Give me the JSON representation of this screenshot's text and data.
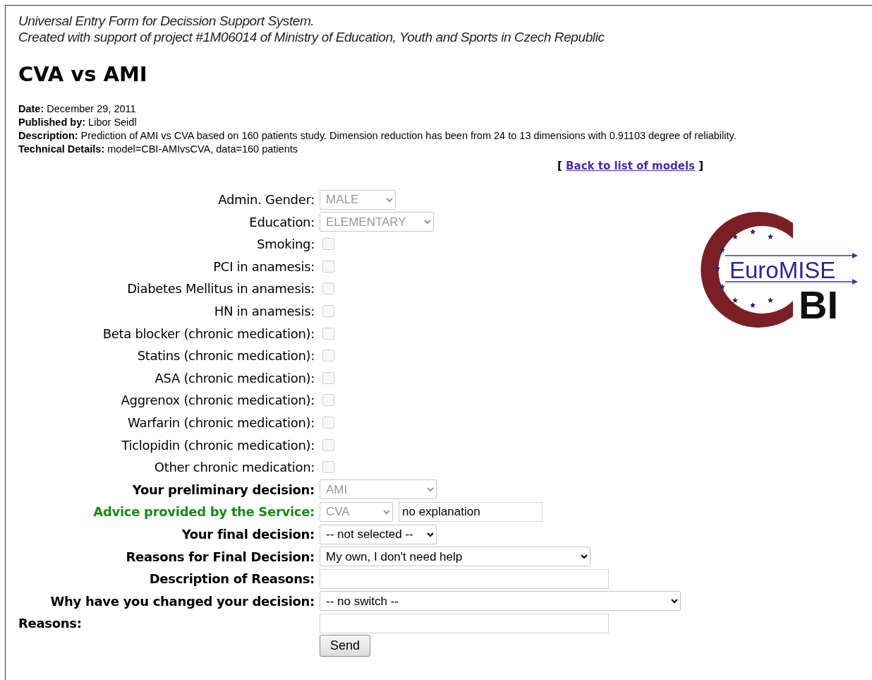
{
  "header": {
    "lines": [
      "Universal Entry Form for Decission Support System.",
      "Created with support of project #1M06014 of Ministry of Education, Youth and Sports in Czech Republic"
    ]
  },
  "title": "CVA vs AMI",
  "meta": [
    {
      "label": "Date:",
      "value": "December 29, 2011"
    },
    {
      "label": "Published by:",
      "value": "Libor Seidl"
    },
    {
      "label": "Description:",
      "value": "Prediction of AMI vs CVA based on 160 patients study. Dimension reduction has been from 24 to 13 dimensions with 0.91103 degree of reliability."
    },
    {
      "label": "Technical Details:",
      "value": "model=CBI-AMIvsCVA, data=160 patients"
    }
  ],
  "back_link": {
    "open": "[",
    "label": "Back to list of models",
    "close": "]"
  },
  "logo": {
    "top_text": "EuroMISE",
    "bottom_text": "BI"
  },
  "form": {
    "rows": [
      {
        "label": "Admin. Gender:",
        "bold": false,
        "color": "#000000",
        "kind": "select",
        "value": "MALE",
        "disabled": true
      },
      {
        "label": "Education:",
        "bold": false,
        "color": "#000000",
        "kind": "select",
        "value": "ELEMENTARY",
        "disabled": true
      },
      {
        "label": "Smoking:",
        "bold": false,
        "color": "#000000",
        "kind": "checkbox",
        "checked": false,
        "disabled": true
      },
      {
        "label": "PCI in anamesis:",
        "bold": false,
        "color": "#000000",
        "kind": "checkbox",
        "checked": false,
        "disabled": true
      },
      {
        "label": "Diabetes Mellitus in anamesis:",
        "bold": false,
        "color": "#000000",
        "kind": "checkbox",
        "checked": false,
        "disabled": true
      },
      {
        "label": "HN in anamesis:",
        "bold": false,
        "color": "#000000",
        "kind": "checkbox",
        "checked": false,
        "disabled": true
      },
      {
        "label": "Beta blocker (chronic medication):",
        "bold": false,
        "color": "#000000",
        "kind": "checkbox",
        "checked": false,
        "disabled": true
      },
      {
        "label": "Statins (chronic medication):",
        "bold": false,
        "color": "#000000",
        "kind": "checkbox",
        "checked": false,
        "disabled": true
      },
      {
        "label": "ASA (chronic medication):",
        "bold": false,
        "color": "#000000",
        "kind": "checkbox",
        "checked": false,
        "disabled": true
      },
      {
        "label": "Aggrenox (chronic medication):",
        "bold": false,
        "color": "#000000",
        "kind": "checkbox",
        "checked": false,
        "disabled": true
      },
      {
        "label": "Warfarin (chronic medication):",
        "bold": false,
        "color": "#000000",
        "kind": "checkbox",
        "checked": false,
        "disabled": true
      },
      {
        "label": "Ticlopidin (chronic medication):",
        "bold": false,
        "color": "#000000",
        "kind": "checkbox",
        "checked": false,
        "disabled": true
      },
      {
        "label": "Other chronic medication:",
        "bold": false,
        "color": "#000000",
        "kind": "checkbox",
        "checked": false,
        "disabled": true
      },
      {
        "label": "Your preliminary decision:",
        "bold": true,
        "color": "#000000",
        "kind": "select",
        "value": "AMI",
        "disabled": true
      },
      {
        "label": "Advice provided by the Service:",
        "bold": true,
        "color": "#1a8a1a",
        "kind": "select",
        "value": "CVA",
        "disabled": true,
        "explanation": "no explanation"
      },
      {
        "label": "Your final decision:",
        "bold": true,
        "color": "#000000",
        "kind": "select",
        "value": "-- not selected --",
        "disabled": false
      },
      {
        "label": "Reasons for Final Decision:",
        "bold": true,
        "color": "#000000",
        "kind": "select",
        "value": "My own, I don't need help",
        "disabled": false
      },
      {
        "label": "Description of Reasons:",
        "bold": true,
        "color": "#000000",
        "kind": "text"
      },
      {
        "label": "Why have you changed your decision:",
        "bold": true,
        "color": "#000000",
        "kind": "select",
        "value": "-- no switch --",
        "disabled": false
      },
      {
        "label": "Reasons:",
        "bold": true,
        "color": "#000000",
        "label_left": true,
        "kind": "text"
      }
    ],
    "submit": "Send"
  }
}
